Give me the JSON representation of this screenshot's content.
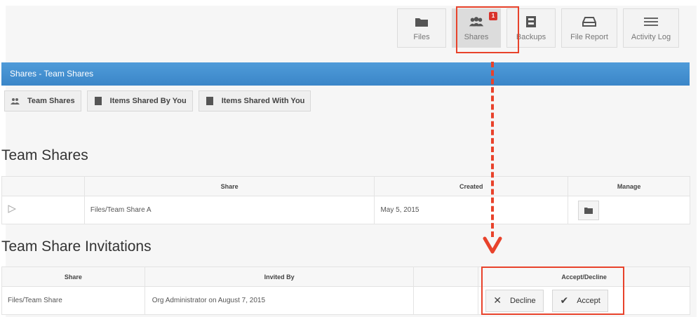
{
  "toolbar": {
    "items": [
      {
        "label": "Files",
        "icon": "folder-icon"
      },
      {
        "label": "Shares",
        "icon": "users-icon",
        "badge": "1"
      },
      {
        "label": "Backups",
        "icon": "archive-icon"
      },
      {
        "label": "File Report",
        "icon": "drive-icon"
      },
      {
        "label": "Activity Log",
        "icon": "list-icon"
      }
    ]
  },
  "header": {
    "title": "Shares - Team Shares"
  },
  "subtabs": [
    {
      "label": "Team Shares",
      "icon": "users-icon"
    },
    {
      "label": "Items Shared By You",
      "icon": "file-icon"
    },
    {
      "label": "Items Shared With You",
      "icon": "file-icon"
    }
  ],
  "team_shares": {
    "title": "Team Shares",
    "columns": [
      "",
      "Share",
      "Created",
      "Manage"
    ],
    "rows": [
      {
        "share": "Files/Team Share A",
        "created": "May 5, 2015"
      }
    ]
  },
  "invitations": {
    "title": "Team Share Invitations",
    "columns": [
      "Share",
      "Invited By",
      "",
      "Accept/Decline"
    ],
    "rows": [
      {
        "share": "Files/Team Share",
        "invited_by": "Org Administrator on August 7, 2015",
        "decline_label": "Decline",
        "accept_label": "Accept"
      }
    ]
  },
  "colors": {
    "accent": "#3b86c8",
    "highlight": "#e8422b",
    "badge": "#d9332b"
  }
}
